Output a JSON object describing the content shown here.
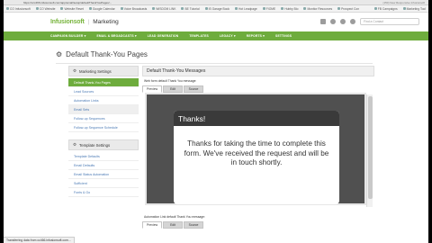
{
  "browser": {
    "url": "https://ccc466.infusionsoft.com/app/email/setup/defaultThankYouPages/...",
    "right_url": "(150) New Responsive Infusionsoft",
    "bookmarks": [
      "CO Infusionsoft",
      "CO Website",
      "Website Reset",
      "Google Calendar",
      "Voice Broadcasts",
      "WISDOM LINK",
      "BE Tutorial",
      "IS Garage Book",
      "Hot Leadpage",
      "FIOME",
      "Hubby Bio",
      "Monitor Resources",
      "Prospect Con"
    ],
    "bookmarks_right": [
      "FB Campaigns",
      "Marketing Tool"
    ]
  },
  "header": {
    "logo": "Infusionsoft",
    "section": "Marketing",
    "search_placeholder": "Find a Contact"
  },
  "nav": {
    "items": [
      "CAMPAIGN BUILDER ▾",
      "EMAIL & BROADCASTS ▾",
      "LEAD GENERATION",
      "TEMPLATES",
      "LEGACY ▾",
      "REPORTS ▾",
      "SETTINGS"
    ]
  },
  "page": {
    "title": "Default Thank-You Pages"
  },
  "sidebar": {
    "section1": "Marketing Settings",
    "items1": [
      "Default Thank-You Pages",
      "Lead Sources",
      "Automation Links",
      "Email Sets",
      "Follow-up Sequences",
      "Follow-up Sequence Schedule"
    ],
    "section2": "Template Settings",
    "items2": [
      "Template Defaults",
      "Email Defaults",
      "Email Status Automation",
      "Sufficient",
      "Fonts & Go"
    ]
  },
  "main": {
    "heading": "Default Thank-You Messages",
    "field1_label": "Web form default Thank You message:",
    "tabs": [
      "Preview",
      "Edit",
      "Source"
    ],
    "modal_title": "Thanks!",
    "modal_body": "Thanks for taking the time to complete this form. We've received the request and will be in touch shortly.",
    "field2_label": "Automation Link default Thank You message:"
  },
  "status_bar": {
    "text": "Transferring data from cc466.infusionsoft.com..."
  }
}
